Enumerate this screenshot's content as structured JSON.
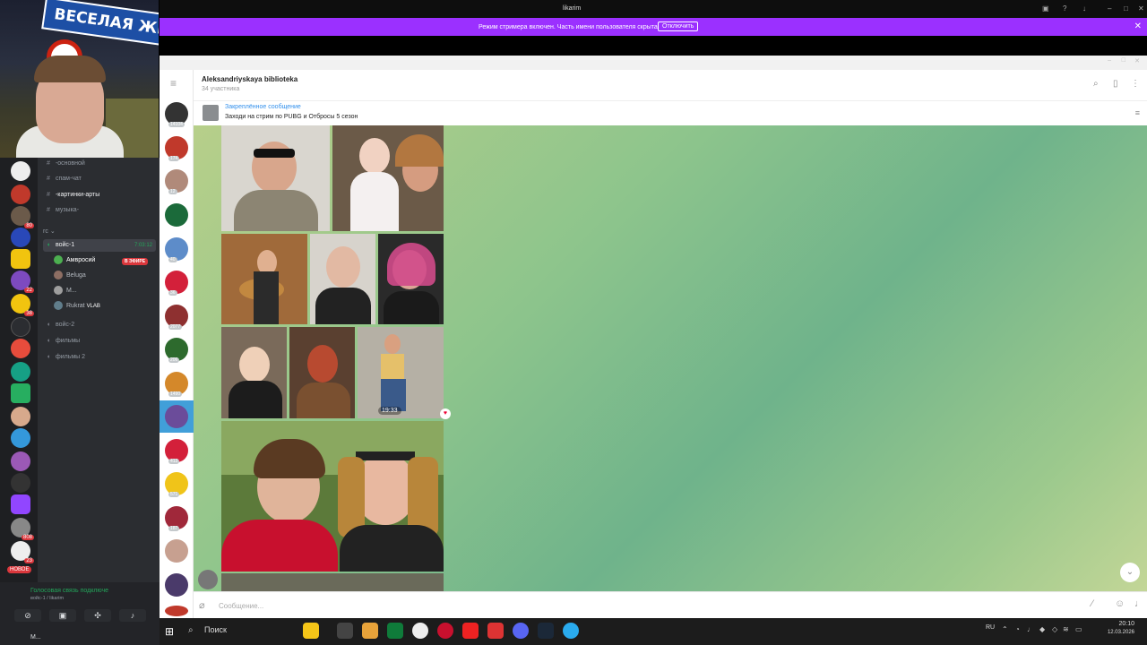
{
  "webcam": {
    "sign_text": "ВЕСЕЛАЯ ЖИЗ"
  },
  "discord": {
    "channels": [
      {
        "name": "-основной",
        "icon": "hash-icon"
      },
      {
        "name": "спам-чат",
        "icon": "hash-icon"
      },
      {
        "name": "-картинки-арты",
        "icon": "hash-icon"
      },
      {
        "name": "музыка-",
        "icon": "hash-icon"
      }
    ],
    "category": "гс",
    "voice_channels": [
      {
        "name": "войс-1",
        "timer": "7:03:12"
      },
      {
        "name": "войс-2"
      },
      {
        "name": "фильмы"
      },
      {
        "name": "фильмы 2"
      }
    ],
    "members": [
      {
        "name": "Амвросий"
      },
      {
        "name": "Beluga"
      },
      {
        "name": "M..."
      },
      {
        "name": "Rukrat",
        "tag": "VLAB"
      }
    ],
    "live_badge": "В ЭФИРЕ",
    "new_badge": "НОВОЕ",
    "server_badges": [
      "80",
      "22",
      "38",
      "808",
      "23"
    ],
    "voice_status": "Голосовая связь подключе",
    "voice_sub": "войс-1 / likarim",
    "user": "M..."
  },
  "window": {
    "title": "likarim"
  },
  "streamer_bar": {
    "text": "Режим стримера включен. Часть имени пользователя скрыта.",
    "button": "Отключить"
  },
  "telegram": {
    "chat_title": "Aleksandriyskaya biblioteka",
    "chat_subtitle": "34 участника",
    "pinned_label": "Закреплённое сообщение",
    "pinned_text": "Заходи на стрим по PUBG и Отбросы 5 сезон",
    "message_time": "19:33",
    "input_placeholder": "Сообщение...",
    "chat_badges": [
      "14104",
      "174",
      "12",
      "",
      "40",
      "36",
      "2077",
      "206",
      "1490",
      "",
      "413",
      "571",
      "187",
      "",
      ""
    ]
  },
  "taskbar": {
    "search_label": "Поиск",
    "lang": "RU",
    "time": "20:10",
    "date": "12.03.2026"
  },
  "colors": {
    "accent": "#9b30ff",
    "telegram_blue": "#3390ec",
    "discord_green": "#23a55a"
  }
}
